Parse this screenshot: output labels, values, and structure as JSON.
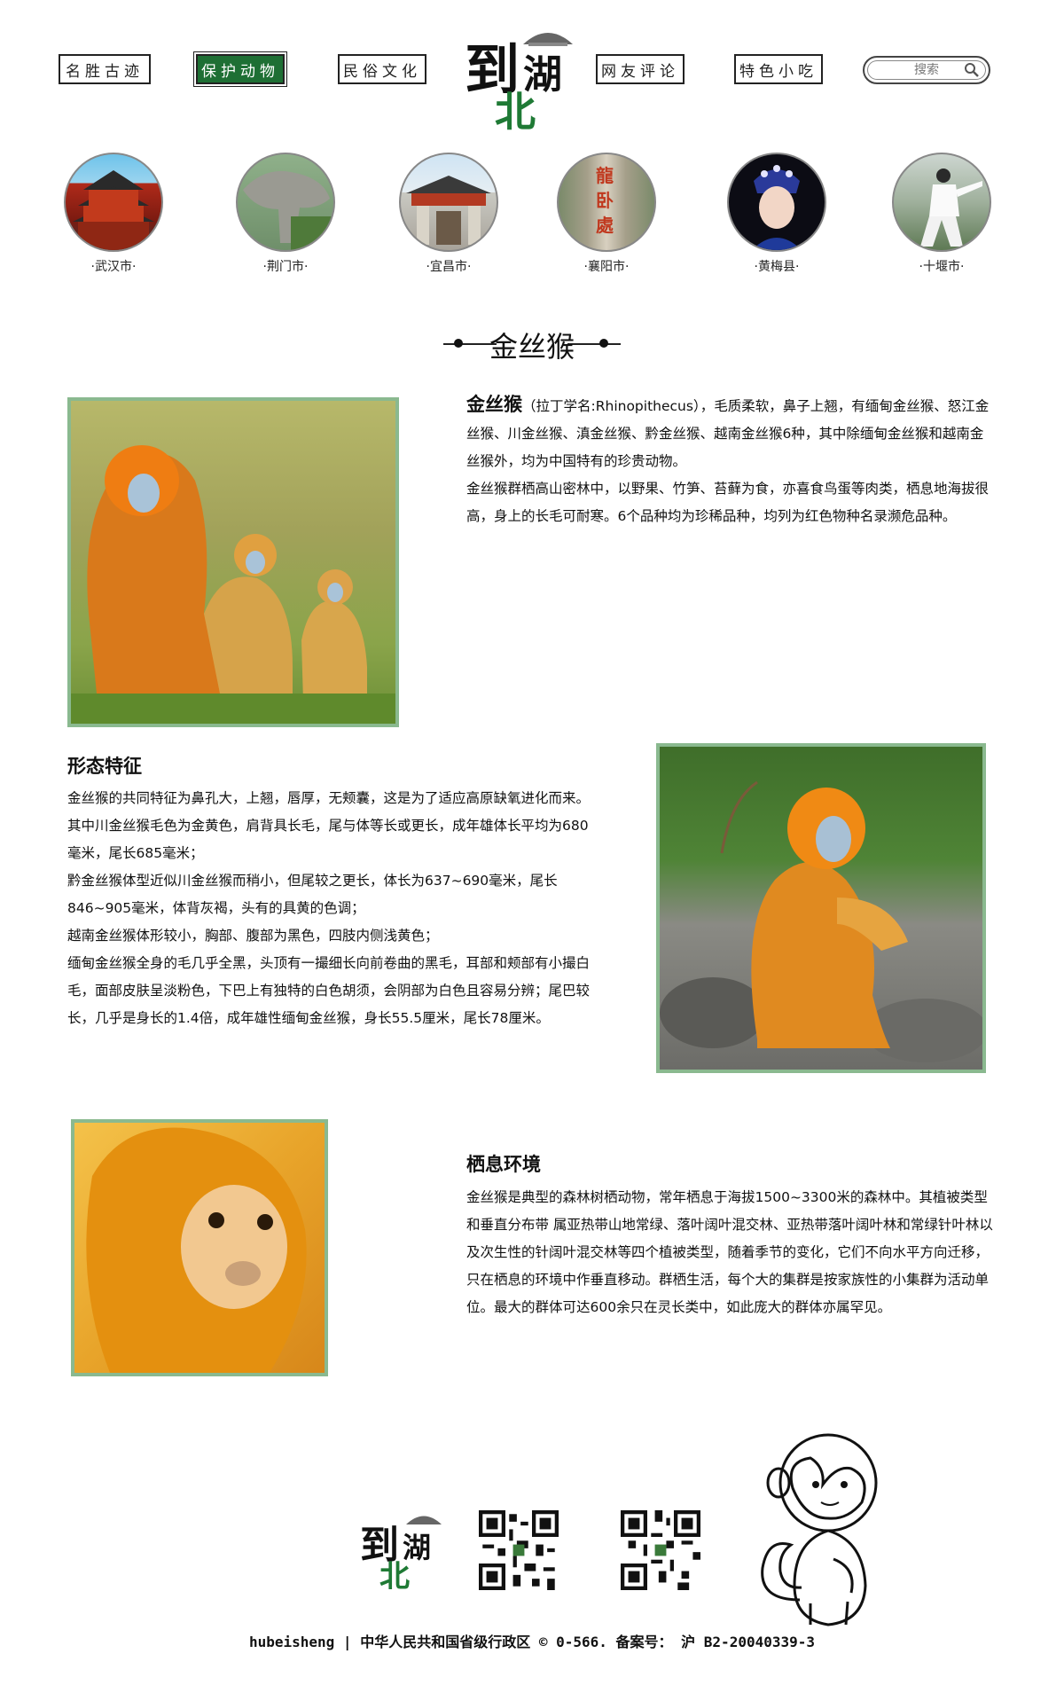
{
  "nav": {
    "items": [
      {
        "label": "名胜古迹",
        "active": false
      },
      {
        "label": "保护动物",
        "active": true
      },
      {
        "label": "民俗文化",
        "active": false
      },
      {
        "label": "网友评论",
        "active": false
      },
      {
        "label": "特色小吃",
        "active": false
      }
    ],
    "search_placeholder": "搜索"
  },
  "logo": {
    "chars": [
      "到",
      "湖",
      "北"
    ]
  },
  "cities": [
    {
      "label": "·武汉市·"
    },
    {
      "label": "·荆门市·"
    },
    {
      "label": "·宜昌市·"
    },
    {
      "label": "·襄阳市·"
    },
    {
      "label": "·黄梅县·"
    },
    {
      "label": "·十堰市·"
    }
  ],
  "city_images": {
    "xiangyang_sign": "龍卧處"
  },
  "section_title": "金丝猴",
  "intro": {
    "name": "金丝猴",
    "latin": "（拉丁学名:Rhinopithecus）",
    "rest_first": "，毛质柔软，鼻子上翘，有缅甸金丝猴、怒江金丝猴、川金丝猴、滇金丝猴、黔金丝猴、越南金丝猴6种，其中除缅甸金丝猴和越南金丝猴外，均为中国特有的珍贵动物。",
    "para2": "金丝猴群栖高山密林中，以野果、竹笋、苔藓为食，亦喜食鸟蛋等肉类，栖息地海拔很高，身上的长毛可耐寒。6个品种均为珍稀品种，均列为红色物种名录濒危品种。"
  },
  "morphology": {
    "heading": "形态特征",
    "paragraphs": [
      "金丝猴的共同特征为鼻孔大，上翘，唇厚，无颊囊，这是为了适应高原缺氧进化而来。",
      "其中川金丝猴毛色为金黄色，肩背具长毛，尾与体等长或更长，成年雄体长平均为680毫米，尾长685毫米；",
      "黔金丝猴体型近似川金丝猴而稍小，但尾较之更长，体长为637~690毫米，尾长846~905毫米，体背灰褐，头有的具黄的色调；",
      "越南金丝猴体形较小，胸部、腹部为黑色，四肢内侧浅黄色；",
      "缅甸金丝猴全身的毛几乎全黑，头顶有一撮细长向前卷曲的黑毛，耳部和颊部有小撮白毛，面部皮肤呈淡粉色，下巴上有独特的白色胡须，会阴部为白色且容易分辨；尾巴较长，几乎是身长的1.4倍，成年雄性缅甸金丝猴，身长55.5厘米，尾长78厘米。"
    ]
  },
  "habitat": {
    "heading": "栖息环境",
    "text": "金丝猴是典型的森林树栖动物，常年栖息于海拔1500~3300米的森林中。其植被类型和垂直分布带 属亚热带山地常绿、落叶阔叶混交林、亚热带落叶阔叶林和常绿针叶林以及次生性的针阔叶混交林等四个植被类型，随着季节的变化，它们不向水平方向迁移，只在栖息的环境中作垂直移动。群栖生活，每个大的集群是按家族性的小集群为活动单位。最大的群体可达600余只在灵长类中，如此庞大的群体亦属罕见。"
  },
  "footer": {
    "text": "hubeisheng | 中华人民共和国省级行政区 © 0-566. 备案号： 沪 B2-20040339-3"
  },
  "colors": {
    "accent_green": "#1e6f34",
    "frame_green": "#8ab98f",
    "logo_green": "#1f7a35"
  }
}
